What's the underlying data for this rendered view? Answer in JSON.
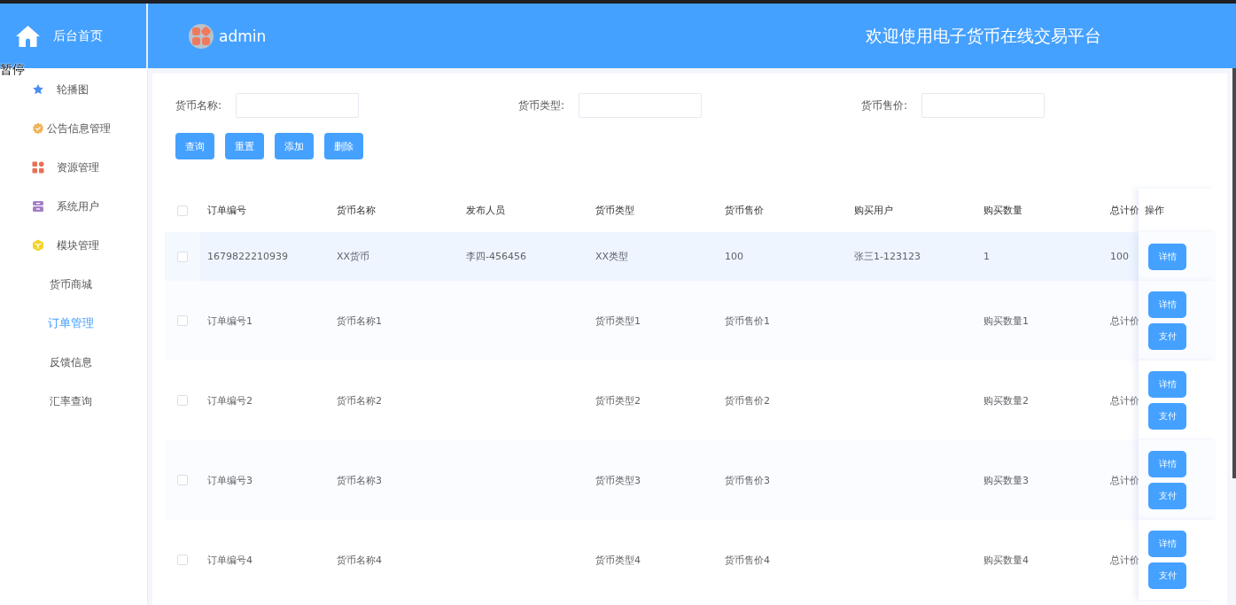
{
  "header": {
    "home_label": "后台首页",
    "user": "admin",
    "welcome": "欢迎使用电子货币在线交易平台"
  },
  "overlay_text": "暂停",
  "sidebar": {
    "items": [
      {
        "label": "轮播图",
        "selected": false
      },
      {
        "label": "公告信息管理",
        "selected": false
      },
      {
        "label": "资源管理",
        "selected": false
      },
      {
        "label": "系统用户",
        "selected": false
      },
      {
        "label": "模块管理",
        "selected": false,
        "children": [
          {
            "label": "货币商城",
            "selected": false
          },
          {
            "label": "订单管理",
            "selected": true
          },
          {
            "label": "反馈信息",
            "selected": false
          },
          {
            "label": "汇率查询",
            "selected": false
          }
        ]
      }
    ]
  },
  "search": {
    "fields": [
      {
        "label": "货币名称:"
      },
      {
        "label": "货币类型:"
      },
      {
        "label": "货币售价:"
      }
    ],
    "buttons": [
      "查询",
      "重置",
      "添加",
      "删除"
    ]
  },
  "table": {
    "header_checked": false,
    "columns": [
      "订单编号",
      "货币名称",
      "发布人员",
      "货币类型",
      "货币售价",
      "购买用户",
      "购买数量",
      "总计价",
      "操作"
    ],
    "rows": [
      {
        "checked": false,
        "hovered": true,
        "cells": [
          "1679822210939",
          "XX货币",
          "李四-456456",
          "XX类型",
          "100",
          "张三1-123123",
          "1",
          "100"
        ],
        "actions": [
          "详情"
        ]
      },
      {
        "checked": false,
        "hovered": false,
        "cells": [
          "订单编号1",
          "货币名称1",
          "",
          "货币类型1",
          "货币售价1",
          "",
          "购买数量1",
          "总计价"
        ],
        "actions": [
          "详情",
          "支付"
        ]
      },
      {
        "checked": false,
        "hovered": false,
        "cells": [
          "订单编号2",
          "货币名称2",
          "",
          "货币类型2",
          "货币售价2",
          "",
          "购买数量2",
          "总计价"
        ],
        "actions": [
          "详情",
          "支付"
        ]
      },
      {
        "checked": false,
        "hovered": false,
        "cells": [
          "订单编号3",
          "货币名称3",
          "",
          "货币类型3",
          "货币售价3",
          "",
          "购买数量3",
          "总计价"
        ],
        "actions": [
          "详情",
          "支付"
        ]
      },
      {
        "checked": false,
        "hovered": false,
        "cells": [
          "订单编号4",
          "货币名称4",
          "",
          "货币类型4",
          "货币售价4",
          "",
          "购买数量4",
          "总计价"
        ],
        "actions": [
          "详情",
          "支付"
        ]
      }
    ]
  }
}
